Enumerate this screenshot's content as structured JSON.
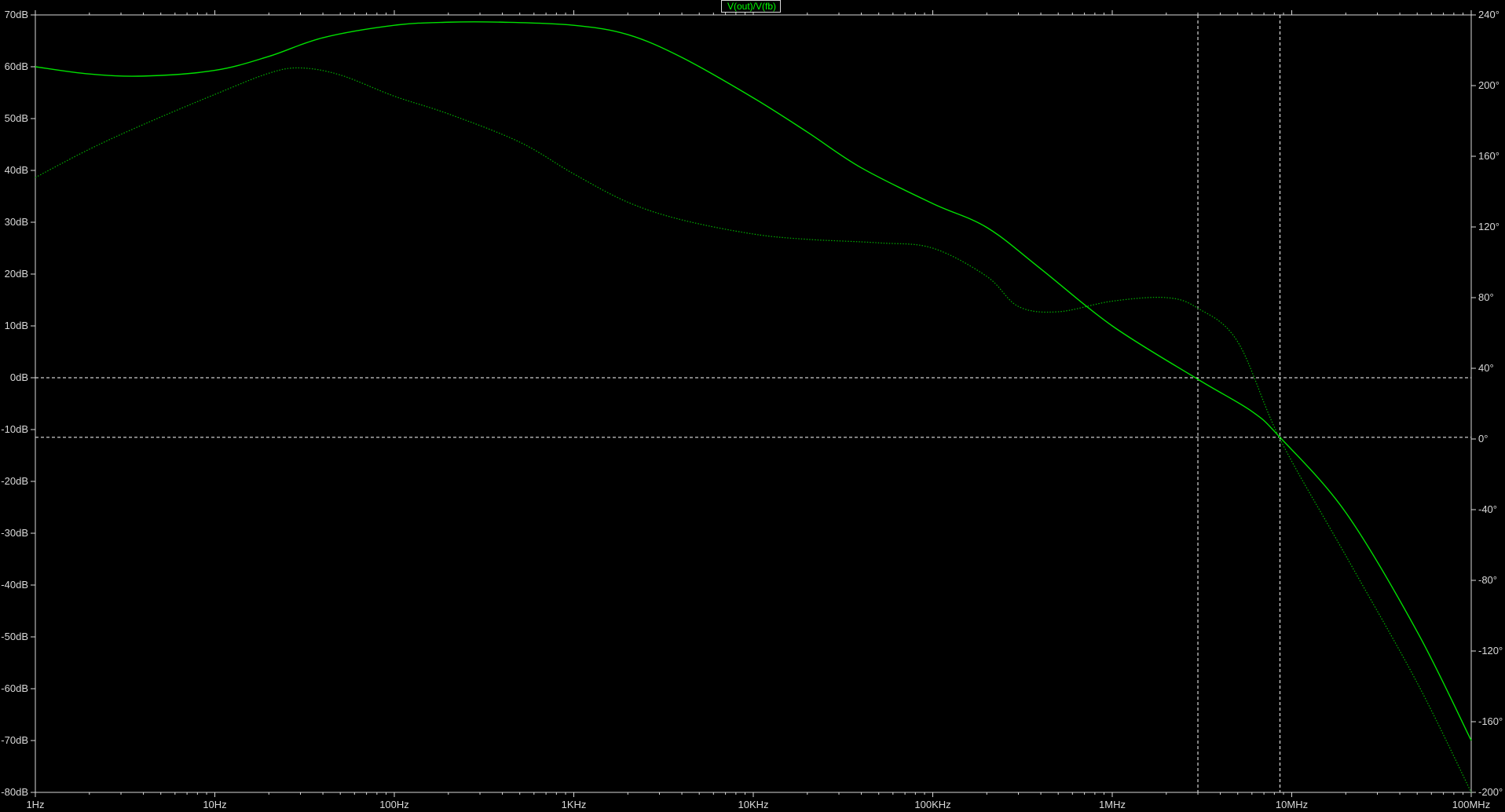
{
  "window": {
    "trace_label": "V(out)/V(fb)"
  },
  "colors": {
    "background": "#000000",
    "axis": "#d9d9d9",
    "magnitude_trace": "#00e000",
    "phase_trace": "#00b000",
    "cursor": "#ffffff"
  },
  "chart_data": {
    "type": "line",
    "title": "V(out)/V(fb)",
    "x_scale": "log",
    "xlim": [
      1,
      100000000
    ],
    "ylim_left": [
      -80,
      70
    ],
    "ylim_right": [
      -200,
      240
    ],
    "x_ticks": [
      {
        "value": 1,
        "label": "1Hz"
      },
      {
        "value": 10,
        "label": "10Hz"
      },
      {
        "value": 100,
        "label": "100Hz"
      },
      {
        "value": 1000,
        "label": "1KHz"
      },
      {
        "value": 10000,
        "label": "10KHz"
      },
      {
        "value": 100000,
        "label": "100KHz"
      },
      {
        "value": 1000000,
        "label": "1MHz"
      },
      {
        "value": 10000000,
        "label": "10MHz"
      },
      {
        "value": 100000000,
        "label": "100MHz"
      }
    ],
    "y_left_ticks": [
      {
        "value": 70,
        "label": "70dB"
      },
      {
        "value": 60,
        "label": "60dB"
      },
      {
        "value": 50,
        "label": "50dB"
      },
      {
        "value": 40,
        "label": "40dB"
      },
      {
        "value": 30,
        "label": "30dB"
      },
      {
        "value": 20,
        "label": "20dB"
      },
      {
        "value": 10,
        "label": "10dB"
      },
      {
        "value": 0,
        "label": "0dB"
      },
      {
        "value": -10,
        "label": "-10dB"
      },
      {
        "value": -20,
        "label": "-20dB"
      },
      {
        "value": -30,
        "label": "-30dB"
      },
      {
        "value": -40,
        "label": "-40dB"
      },
      {
        "value": -50,
        "label": "-50dB"
      },
      {
        "value": -60,
        "label": "-60dB"
      },
      {
        "value": -70,
        "label": "-70dB"
      },
      {
        "value": -80,
        "label": "-80dB"
      }
    ],
    "y_right_ticks": [
      {
        "value": 240,
        "label": "240°"
      },
      {
        "value": 200,
        "label": "200°"
      },
      {
        "value": 160,
        "label": "160°"
      },
      {
        "value": 120,
        "label": "120°"
      },
      {
        "value": 80,
        "label": "80°"
      },
      {
        "value": 40,
        "label": "40°"
      },
      {
        "value": 0,
        "label": "0°"
      },
      {
        "value": -40,
        "label": "-40°"
      },
      {
        "value": -80,
        "label": "-80°"
      },
      {
        "value": -120,
        "label": "-120°"
      },
      {
        "value": -160,
        "label": "-160°"
      },
      {
        "value": -200,
        "label": "-200°"
      }
    ],
    "series": [
      {
        "axis": "left",
        "style": "solid",
        "x": [
          1,
          2,
          4,
          10,
          20,
          40,
          100,
          200,
          400,
          1000,
          2000,
          4000,
          10000,
          20000,
          40000,
          100000,
          200000,
          400000,
          1000000,
          3000000,
          6000000,
          8600000,
          20000000,
          50000000,
          100000000
        ],
        "values": [
          60,
          58.6,
          58.2,
          59.3,
          62,
          65.6,
          68,
          68.6,
          68.6,
          68,
          66.2,
          61.8,
          54,
          47.4,
          40.5,
          33.6,
          29,
          21,
          10,
          -0.3,
          -6.5,
          -11.5,
          -26,
          -49,
          -70
        ]
      },
      {
        "axis": "right",
        "style": "dotted",
        "x": [
          1,
          2,
          4,
          10,
          20,
          30,
          50,
          100,
          200,
          500,
          1000,
          2000,
          4000,
          10000,
          20000,
          50000,
          100000,
          200000,
          300000,
          500000,
          1000000,
          2000000,
          3000000,
          5000000,
          8600000,
          20000000,
          50000000,
          100000000
        ],
        "values": [
          148,
          164,
          178,
          195,
          207,
          210,
          206,
          194,
          184,
          168,
          150,
          134,
          124,
          116,
          113,
          111,
          108,
          92,
          75,
          72,
          78,
          80,
          74,
          55,
          0,
          -66,
          -138,
          -200
        ]
      }
    ],
    "cursors": {
      "x": [
        3000000,
        8600000
      ],
      "y_left": [
        0,
        -11.5
      ]
    }
  }
}
